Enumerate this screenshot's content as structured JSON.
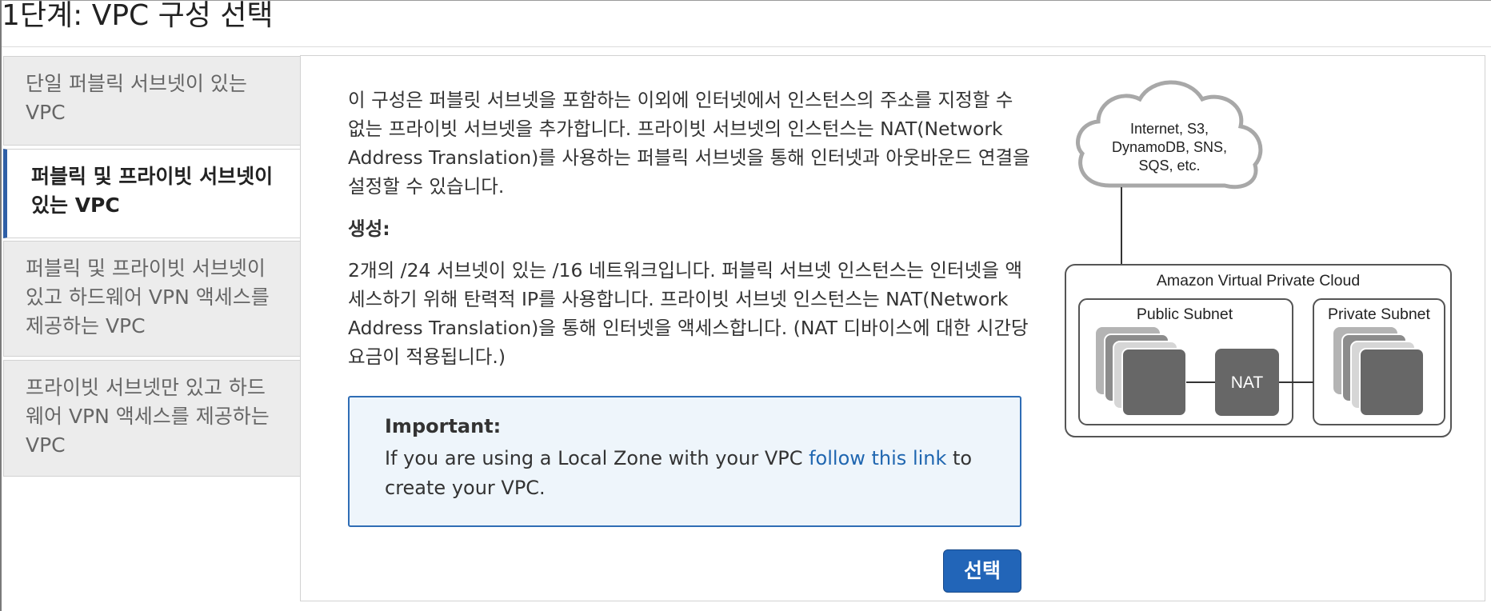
{
  "page": {
    "title": "1단계: VPC 구성 선택"
  },
  "sidebar": {
    "items": [
      {
        "label": "단일 퍼블릭 서브넷이 있는 VPC",
        "active": false
      },
      {
        "label": "퍼블릭 및 프라이빗 서브넷이 있는 VPC",
        "active": true
      },
      {
        "label": "퍼블릭 및 프라이빗 서브넷이 있고 하드웨어 VPN 액세스를 제공하는 VPC",
        "active": false
      },
      {
        "label": "프라이빗 서브넷만 있고 하드웨어 VPN 액세스를 제공하는 VPC",
        "active": false
      }
    ]
  },
  "main": {
    "description": "이 구성은 퍼블릿 서브넷을 포함하는 이외에 인터넷에서 인스턴스의 주소를 지정할 수 없는 프라이빗 서브넷을 추가합니다. 프라이빗 서브넷의 인스턴스는 NAT(Network Address Translation)를 사용하는 퍼블릭 서브넷을 통해 인터넷과 아웃바운드 연결을 설정할 수 있습니다.",
    "create_label": "생성:",
    "create_text": "2개의 /24 서브넷이 있는 /16 네트워크입니다. 퍼블릭 서브넷 인스턴스는 인터넷을 액세스하기 위해 탄력적 IP를 사용합니다. 프라이빗 서브넷 인스턴스는 NAT(Network Address Translation)을 통해 인터넷을 액세스합니다. (NAT 디바이스에 대한 시간당 요금이 적용됩니다.)",
    "important": {
      "title": "Important:",
      "text_before": "If you are using a Local Zone with your VPC ",
      "link": "follow this link",
      "text_after": " to create your VPC."
    },
    "select_button": "선택"
  },
  "diagram": {
    "cloud_lines": [
      "Internet, S3,",
      "DynamoDB, SNS,",
      "SQS, etc."
    ],
    "vpc_label": "Amazon Virtual Private Cloud",
    "public_subnet": "Public Subnet",
    "private_subnet": "Private Subnet",
    "nat": "NAT"
  },
  "colors": {
    "accent": "#2265b8",
    "active_tab_border": "#2f5fa6",
    "link": "#1f66b0",
    "info_bg": "#eef5fb",
    "info_border": "#2f6db5",
    "instance_box": "#666666"
  }
}
